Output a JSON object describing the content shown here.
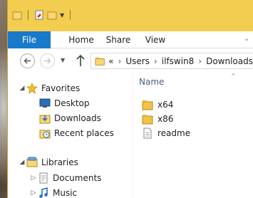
{
  "window": {
    "tabs": {
      "file": "File",
      "home": "Home",
      "share": "Share",
      "view": "View"
    },
    "address": {
      "overflow": "«",
      "segments": [
        "Users",
        "ilfswin8",
        "Downloads"
      ],
      "separator": "›"
    }
  },
  "navpane": {
    "favorites": {
      "label": "Favorites",
      "items": [
        {
          "label": "Desktop",
          "icon": "desktop-icon"
        },
        {
          "label": "Downloads",
          "icon": "downloads-folder-icon"
        },
        {
          "label": "Recent places",
          "icon": "recent-places-icon"
        }
      ]
    },
    "libraries": {
      "label": "Libraries",
      "items": [
        {
          "label": "Documents",
          "icon": "documents-icon"
        },
        {
          "label": "Music",
          "icon": "music-icon"
        }
      ]
    }
  },
  "filelist": {
    "column_name": "Name",
    "sort_indicator": "^",
    "files": [
      {
        "label": "x64",
        "icon": "folder-icon"
      },
      {
        "label": "x86",
        "icon": "folder-icon"
      },
      {
        "label": "readme",
        "icon": "text-file-icon"
      }
    ]
  },
  "colors": {
    "titlebar": "#f3cd4f",
    "file_tab": "#1979ca",
    "folder": "#f0c24a"
  }
}
